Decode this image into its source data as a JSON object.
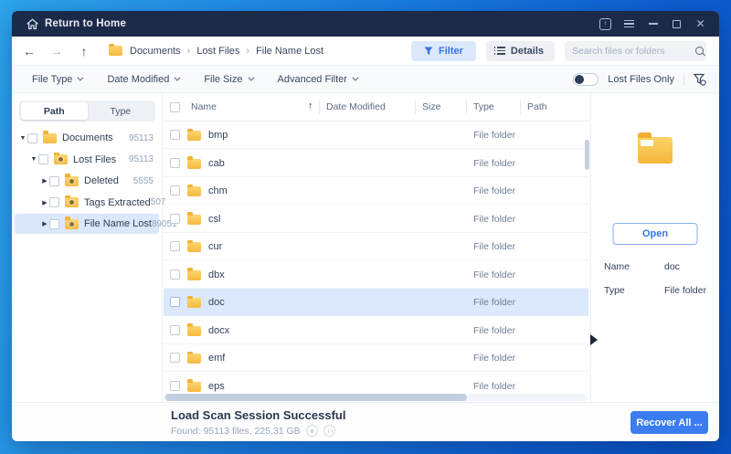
{
  "titlebar": {
    "title": "Return to Home",
    "icons": [
      "upgrade-icon",
      "menu-icon",
      "minimize-icon",
      "maximize-icon",
      "close-icon"
    ]
  },
  "nav": {
    "breadcrumb": [
      "Documents",
      "Lost Files",
      "File Name Lost"
    ],
    "filter_label": "Filter",
    "details_label": "Details",
    "search_placeholder": "Search files or folders"
  },
  "filterbar": {
    "dropdowns": [
      "File Type",
      "Date Modified",
      "File Size",
      "Advanced Filter"
    ],
    "toggle_label": "Lost Files Only",
    "toggle_state": "off"
  },
  "sidebar": {
    "tabs": [
      {
        "label": "Path",
        "active": true
      },
      {
        "label": "Type",
        "active": false
      }
    ],
    "tree": [
      {
        "label": "Documents",
        "count": "95113",
        "level": 0,
        "expanded": true,
        "badge": "none",
        "selected": false
      },
      {
        "label": "Lost Files",
        "count": "95113",
        "level": 1,
        "expanded": true,
        "badge": "lost-badge",
        "selected": false
      },
      {
        "label": "Deleted",
        "count": "5555",
        "level": 2,
        "expanded": false,
        "badge": "deleted-badge",
        "selected": false
      },
      {
        "label": "Tags Extracted",
        "count": "507",
        "level": 2,
        "expanded": false,
        "badge": "tags-badge",
        "selected": false
      },
      {
        "label": "File Name Lost",
        "count": "89051",
        "level": 2,
        "expanded": false,
        "badge": "question-badge",
        "selected": true
      }
    ]
  },
  "table": {
    "columns": {
      "name": "Name",
      "date": "Date Modified",
      "size": "Size",
      "type": "Type",
      "path": "Path"
    },
    "sort_icon": "↑",
    "rows": [
      {
        "name": "bmp",
        "type": "File folder",
        "selected": false
      },
      {
        "name": "cab",
        "type": "File folder",
        "selected": false
      },
      {
        "name": "chm",
        "type": "File folder",
        "selected": false
      },
      {
        "name": "csl",
        "type": "File folder",
        "selected": false
      },
      {
        "name": "cur",
        "type": "File folder",
        "selected": false
      },
      {
        "name": "dbx",
        "type": "File folder",
        "selected": false
      },
      {
        "name": "doc",
        "type": "File folder",
        "selected": true
      },
      {
        "name": "docx",
        "type": "File folder",
        "selected": false
      },
      {
        "name": "emf",
        "type": "File folder",
        "selected": false
      },
      {
        "name": "eps",
        "type": "File folder",
        "selected": false
      }
    ]
  },
  "detail": {
    "open_label": "Open",
    "fields": [
      {
        "label": "Name",
        "value": "doc"
      },
      {
        "label": "Type",
        "value": "File folder"
      }
    ]
  },
  "statusbar": {
    "title": "Load Scan Session Successful",
    "subtitle": "Found: 95113 files, 225.31 GB",
    "recover_label": "Recover All ..."
  },
  "colors": {
    "accent": "#3673e8",
    "titlebar": "#1c2a4a",
    "selection": "#dce9fc",
    "folder": "#f6b93f"
  }
}
